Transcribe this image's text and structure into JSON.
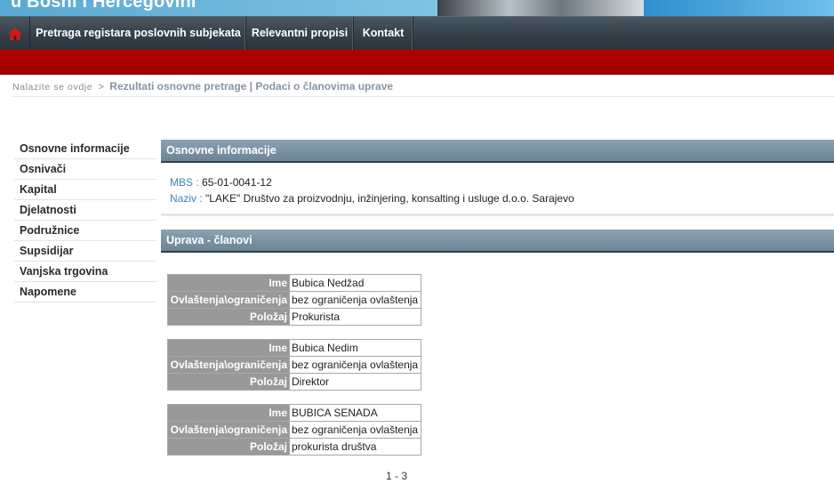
{
  "header": {
    "title": "u Bosni i Hercegovini"
  },
  "nav": {
    "home_icon": "home-icon",
    "items": [
      {
        "label": "Pretraga registara poslovnih subjekata"
      },
      {
        "label": "Relevantni propisi"
      },
      {
        "label": "Kontakt"
      }
    ]
  },
  "breadcrumb": {
    "prefix": "Nalazite se ovdje",
    "separator": ">",
    "current": "Rezultati osnovne pretrage | Podaci o članovima uprave"
  },
  "sidebar": {
    "items": [
      {
        "label": "Osnovne informacije"
      },
      {
        "label": "Osnivači"
      },
      {
        "label": "Kapital"
      },
      {
        "label": "Djelatnosti"
      },
      {
        "label": "Podružnice"
      },
      {
        "label": "Supsidijar"
      },
      {
        "label": "Vanjska trgovina"
      },
      {
        "label": "Napomene"
      }
    ]
  },
  "basic_info": {
    "title": "Osnovne informacije",
    "mbs_label": "MBS :",
    "mbs_value": "65-01-0041-12",
    "naziv_label": "Naziv :",
    "naziv_value": "\"LAKE\" Društvo za proizvodnju, inžinjering, konsalting i usluge d.o.o. Sarajevo"
  },
  "management": {
    "title": "Uprava - članovi",
    "labels": {
      "name": "Ime",
      "authority": "Ovlaštenja\\ograničenja",
      "position": "Položaj"
    },
    "members": [
      {
        "name": "Bubica Nedžad",
        "authority": "bez ograničenja ovlaštenja",
        "position": "Prokurista"
      },
      {
        "name": "Bubica Nedim",
        "authority": "bez ograničenja ovlaštenja",
        "position": "Direktor"
      },
      {
        "name": "BUBICA SENADA",
        "authority": "bez ograničenja ovlaštenja",
        "position": "prokurista društva"
      }
    ],
    "pager": "1 - 3"
  },
  "colors": {
    "nav_bg": "#34404a",
    "red_bar": "#a80000",
    "section_header": "#7a92a1",
    "label_cell": "#999999",
    "link_label": "#3d86b3"
  }
}
